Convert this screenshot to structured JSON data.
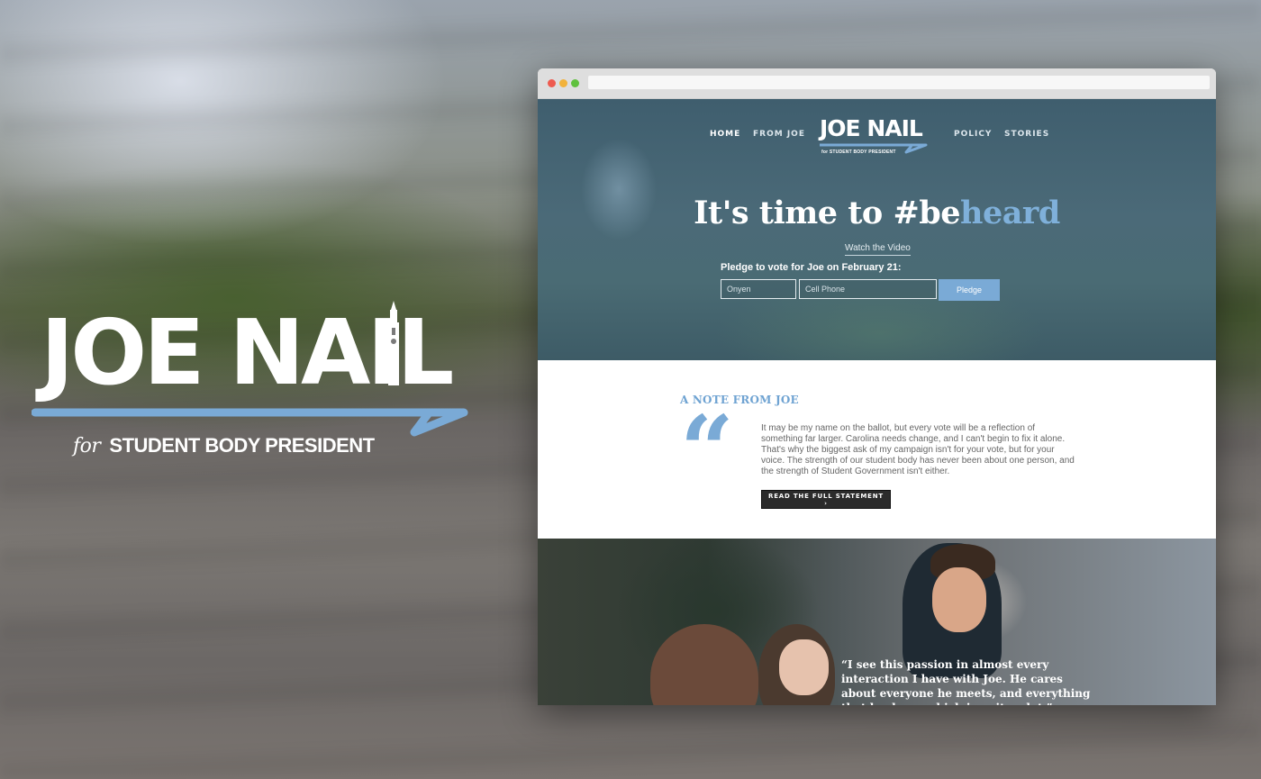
{
  "colors": {
    "accent_blue": "#7aaad6",
    "hero_overlay": "#45656f",
    "dark_button": "#2b2b2b"
  },
  "left_logo": {
    "wordmark": "JOE NAIL",
    "tagline_for": "for",
    "tagline_rest": "STUDENT BODY PRESIDENT"
  },
  "browser": {
    "url": ""
  },
  "site": {
    "nav": {
      "home": "HOME",
      "from_joe": "FROM JOE",
      "policy": "POLICY",
      "stories": "STORIES",
      "logo_wordmark": "JOE NAIL",
      "logo_sub": "for STUDENT BODY PRESIDENT"
    },
    "hero": {
      "headline_part1": "It's time to #be",
      "headline_part2": "heard",
      "watch_link": "Watch the Video",
      "pledge_label": "Pledge to vote for Joe on February 21:",
      "onyen_placeholder": "Onyen",
      "cell_placeholder": "Cell Phone",
      "pledge_button": "Pledge"
    },
    "note": {
      "heading": "A NOTE FROM JOE",
      "quote_mark": "“",
      "body": "It may be my name on the ballot, but every vote will be a reflection of something far larger. Carolina needs change, and I can't begin to fix it alone. That's why the biggest ask of my campaign isn't for your vote, but for your voice. The strength of our student body has never been about one person, and the strength of Student Government isn't either.",
      "read_button": "READ THE FULL STATEMENT ›"
    },
    "stories": {
      "quote": "“I see this passion in almost every interaction I have with Joe. He cares about everyone he meets, and everything that he does—which is quite a lot.”"
    }
  }
}
